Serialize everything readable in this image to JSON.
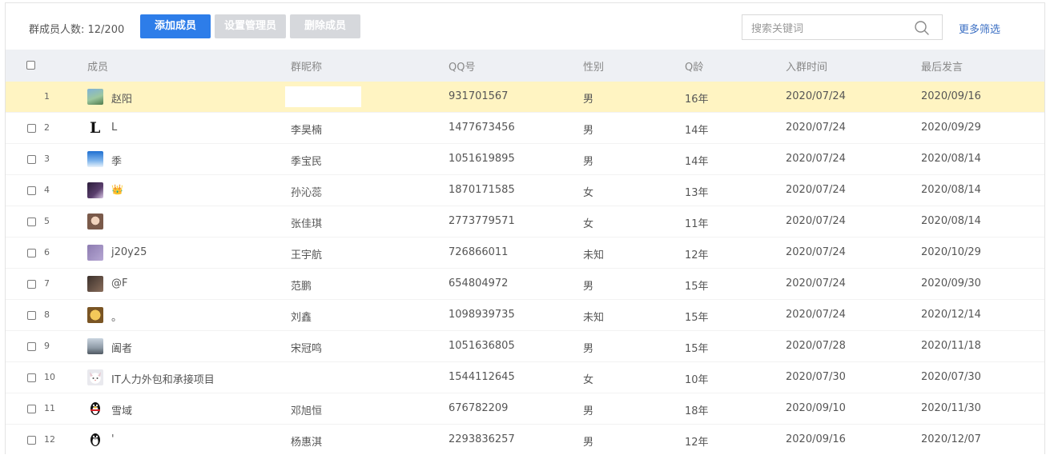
{
  "toolbar": {
    "member_count": "群成员人数: 12/200",
    "add_label": "添加成员",
    "admin_label": "设置管理员",
    "delete_label": "删除成员",
    "search_placeholder": "搜索关键词",
    "more_filter": "更多筛选"
  },
  "columns": [
    "成员",
    "群昵称",
    "QQ号",
    "性别",
    "Q龄",
    "入群时间",
    "最后发言"
  ],
  "rows": [
    {
      "no": "1",
      "member": "赵阳",
      "nick": "",
      "qq": "931701567",
      "gender": "男",
      "age": "16年",
      "join": "2020/07/24",
      "last": "2020/09/16",
      "avatar": "landscape",
      "highlight": true
    },
    {
      "no": "2",
      "member": "L",
      "nick": "李昊楠",
      "qq": "1477673456",
      "gender": "男",
      "age": "14年",
      "join": "2020/07/24",
      "last": "2020/09/29",
      "avatar": "letter-L"
    },
    {
      "no": "3",
      "member": "季",
      "nick": "季宝民",
      "qq": "1051619895",
      "gender": "男",
      "age": "14年",
      "join": "2020/07/24",
      "last": "2020/08/14",
      "avatar": "sky"
    },
    {
      "no": "4",
      "member": "👑",
      "nick": "孙沁蕊",
      "qq": "1870171585",
      "gender": "女",
      "age": "13年",
      "join": "2020/07/24",
      "last": "2020/08/14",
      "avatar": "anime"
    },
    {
      "no": "5",
      "member": "",
      "nick": "张佳琪",
      "qq": "2773779571",
      "gender": "女",
      "age": "11年",
      "join": "2020/07/24",
      "last": "2020/08/14",
      "avatar": "face"
    },
    {
      "no": "6",
      "member": "j20y25",
      "nick": "王宇航",
      "qq": "726866011",
      "gender": "未知",
      "age": "12年",
      "join": "2020/07/24",
      "last": "2020/10/29",
      "avatar": "purple"
    },
    {
      "no": "7",
      "member": "@F",
      "nick": "范鹏",
      "qq": "654804972",
      "gender": "男",
      "age": "15年",
      "join": "2020/07/24",
      "last": "2020/09/30",
      "avatar": "dark"
    },
    {
      "no": "8",
      "member": "。",
      "nick": "刘鑫",
      "qq": "1098939735",
      "gender": "未知",
      "age": "15年",
      "join": "2020/07/24",
      "last": "2020/12/14",
      "avatar": "yellow"
    },
    {
      "no": "9",
      "member": "阖者",
      "nick": "宋冠鸣",
      "qq": "1051636805",
      "gender": "男",
      "age": "15年",
      "join": "2020/07/28",
      "last": "2020/11/18",
      "avatar": "city"
    },
    {
      "no": "10",
      "member": "IT人力外包和承接项目",
      "nick": "",
      "qq": "1544112645",
      "gender": "女",
      "age": "10年",
      "join": "2020/07/30",
      "last": "2020/07/30",
      "avatar": "cat"
    },
    {
      "no": "11",
      "member": "雪域",
      "nick": "邓旭恒",
      "qq": "676782209",
      "gender": "男",
      "age": "18年",
      "join": "2020/09/10",
      "last": "2020/11/30",
      "avatar": "penguin"
    },
    {
      "no": "12",
      "member": "'",
      "nick": "杨惠淇",
      "qq": "2293836257",
      "gender": "男",
      "age": "12年",
      "join": "2020/09/16",
      "last": "2020/12/07",
      "avatar": "penguin-bw"
    }
  ],
  "colors": {
    "primary": "#2d7de9",
    "disabled": "#d6d8dc",
    "header_bg": "#eef0f4",
    "highlight": "#fff4c2",
    "link": "#3b6fc3"
  }
}
